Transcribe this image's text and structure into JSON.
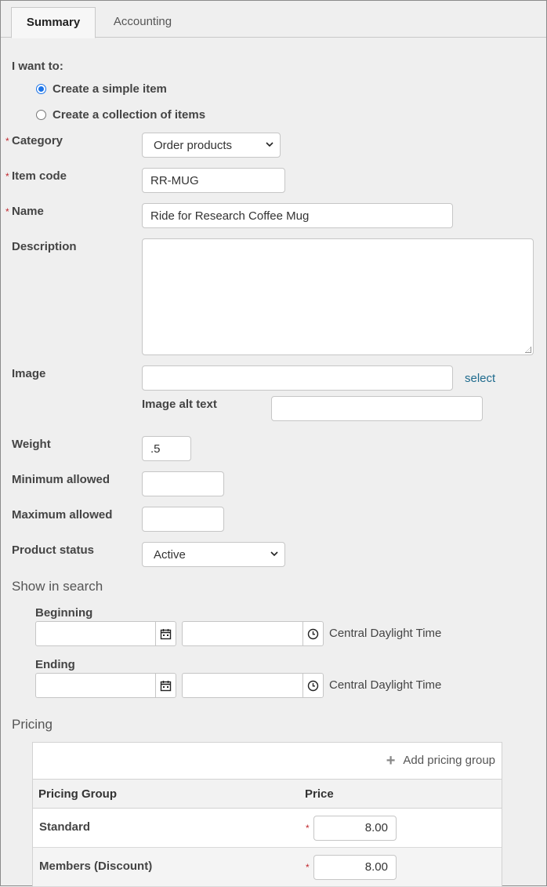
{
  "tabs": [
    {
      "label": "Summary",
      "active": true
    },
    {
      "label": "Accounting",
      "active": false
    }
  ],
  "intent": {
    "label": "I want to:",
    "options": [
      {
        "label": "Create a simple item",
        "selected": true
      },
      {
        "label": "Create a collection of items",
        "selected": false
      }
    ]
  },
  "required_marker": "*",
  "form": {
    "category": {
      "label": "Category",
      "value": "Order products"
    },
    "item_code": {
      "label": "Item code",
      "value": "RR-MUG"
    },
    "name": {
      "label": "Name",
      "value": "Ride for Research Coffee Mug"
    },
    "description": {
      "label": "Description",
      "value": ""
    },
    "image": {
      "label": "Image",
      "value": "",
      "select_link": "select"
    },
    "image_alt": {
      "label": "Image alt text",
      "value": ""
    },
    "weight": {
      "label": "Weight",
      "value": ".5"
    },
    "minimum": {
      "label": "Minimum allowed",
      "value": ""
    },
    "maximum": {
      "label": "Maximum allowed",
      "value": ""
    },
    "product_status": {
      "label": "Product status",
      "value": "Active"
    }
  },
  "show_in_search": {
    "title": "Show in search",
    "beginning": {
      "label": "Beginning",
      "date": "",
      "time": "",
      "timezone": "Central Daylight Time"
    },
    "ending": {
      "label": "Ending",
      "date": "",
      "time": "",
      "timezone": "Central Daylight Time"
    }
  },
  "pricing": {
    "title": "Pricing",
    "add_button": "Add pricing group",
    "columns": [
      "Pricing Group",
      "Price"
    ],
    "rows": [
      {
        "group": "Standard",
        "price": "8.00"
      },
      {
        "group": "Members (Discount)",
        "price": "8.00"
      }
    ]
  }
}
